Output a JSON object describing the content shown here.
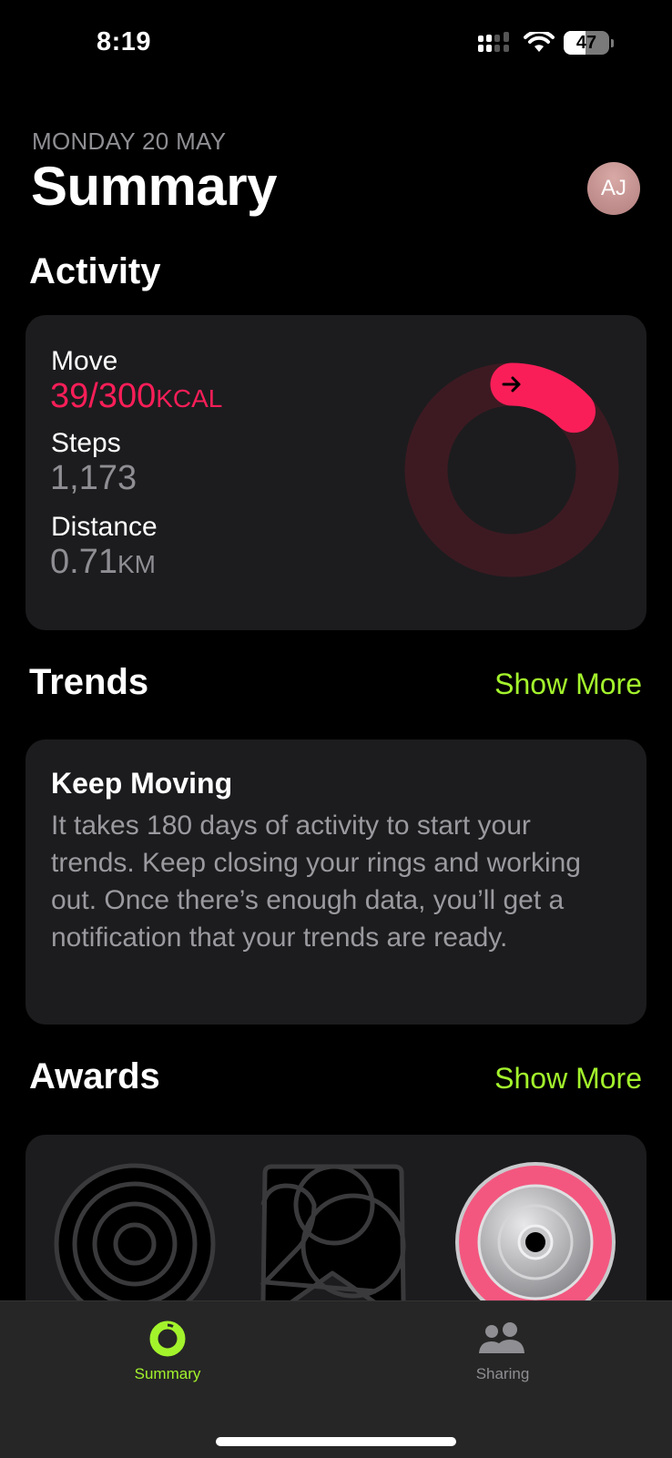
{
  "status_bar": {
    "time": "8:19",
    "battery_percent": 47,
    "battery_label": "47",
    "icons": [
      "cellular-signal-icon",
      "wifi-icon",
      "battery-icon"
    ]
  },
  "header": {
    "date": "MONDAY 20 MAY",
    "title": "Summary",
    "avatar_initials": "AJ"
  },
  "activity": {
    "section_title": "Activity",
    "move": {
      "label": "Move",
      "value": "39/300",
      "unit": "KCAL",
      "current": 39,
      "goal": 300,
      "color": "#fa1e58"
    },
    "steps": {
      "label": "Steps",
      "value": "1,173"
    },
    "distance": {
      "label": "Distance",
      "value": "0.71",
      "unit": "KM"
    },
    "ring": {
      "progress_fraction": 0.13,
      "icon": "arrow-right-icon",
      "track_color": "#3d1a22",
      "fill_color": "#fa1e58"
    }
  },
  "trends": {
    "section_title": "Trends",
    "show_more": "Show More",
    "card_title": "Keep Moving",
    "card_body": "It takes 180 days of activity to start your trends. Keep closing your rings and working out. Once there’s enough data, you’ll get a notification that your trends are ready."
  },
  "awards": {
    "section_title": "Awards",
    "show_more": "Show More",
    "items": [
      {
        "name": "concentric-rings-award",
        "earned": false
      },
      {
        "name": "year-2024-award",
        "earned": false
      },
      {
        "name": "move-goal-award",
        "earned": true
      }
    ]
  },
  "tab_bar": {
    "tabs": [
      {
        "label": "Summary",
        "icon": "activity-ring-icon",
        "active": true,
        "color": "#a3f32c"
      },
      {
        "label": "Sharing",
        "icon": "people-icon",
        "active": false,
        "color": "#8e8e93"
      }
    ]
  },
  "colors": {
    "accent": "#a3f32c",
    "move": "#fa1e58",
    "card": "#1c1c1e"
  }
}
